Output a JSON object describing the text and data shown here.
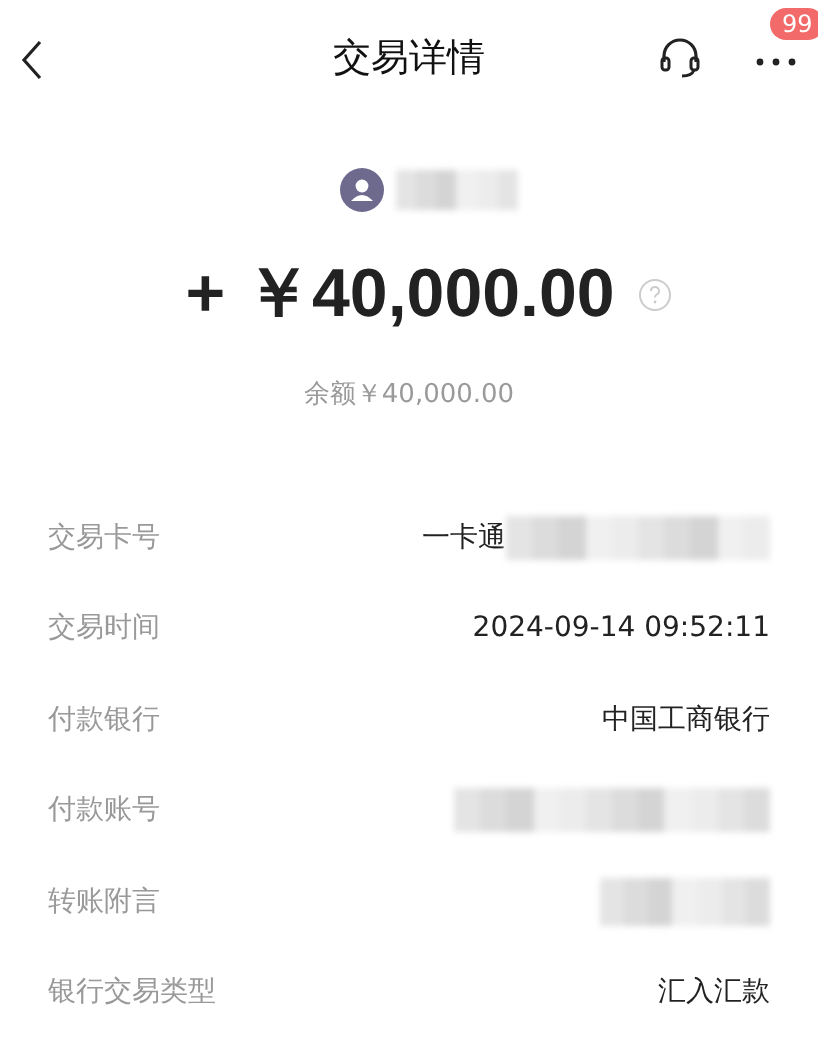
{
  "header": {
    "title": "交易详情",
    "badge": "99"
  },
  "payee": {
    "name_redacted": true
  },
  "amount": "+ ￥40,000.00",
  "balance": "余额￥40,000.00",
  "rows": [
    {
      "label": "交易卡号",
      "kind": "text_redacted",
      "value": "一卡通"
    },
    {
      "label": "交易时间",
      "kind": "text",
      "value": "2024-09-14 09:52:11"
    },
    {
      "label": "付款银行",
      "kind": "text",
      "value": "中国工商银行"
    },
    {
      "label": "付款账号",
      "kind": "redacted"
    },
    {
      "label": "转账附言",
      "kind": "redacted_short"
    },
    {
      "label": "银行交易类型",
      "kind": "text",
      "value": "汇入汇款"
    }
  ]
}
